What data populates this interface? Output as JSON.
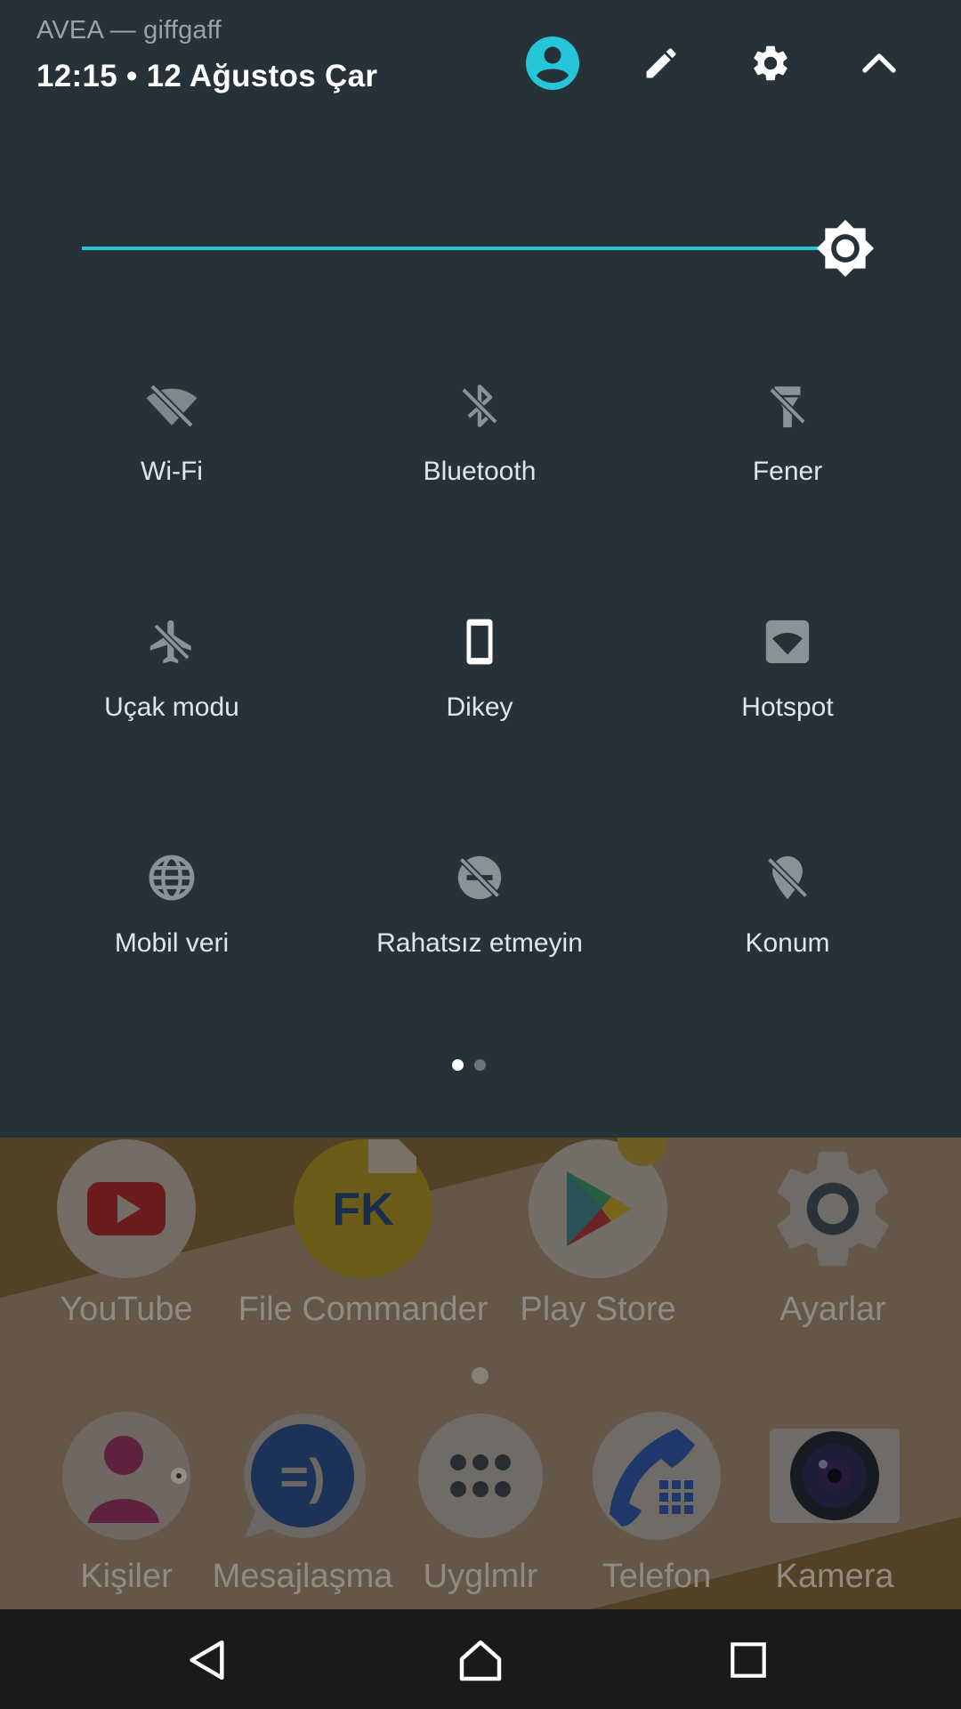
{
  "header": {
    "carrier": "AVEA — giffgaff",
    "datetime": "12:15 • 12 Ağustos Çar"
  },
  "header_icons": [
    "user-icon",
    "edit-icon",
    "settings-icon",
    "chevron-up-icon"
  ],
  "brightness": {
    "level": 0.98,
    "accent_color": "#26c6da"
  },
  "tiles": [
    {
      "label": "Wi-Fi",
      "icon": "wifi-off-icon",
      "state": "off"
    },
    {
      "label": "Bluetooth",
      "icon": "bluetooth-off-icon",
      "state": "off"
    },
    {
      "label": "Fener",
      "icon": "flashlight-off-icon",
      "state": "off"
    },
    {
      "label": "Uçak modu",
      "icon": "airplane-off-icon",
      "state": "off"
    },
    {
      "label": "Dikey",
      "icon": "portrait-phone-icon",
      "state": "on"
    },
    {
      "label": "Hotspot",
      "icon": "hotspot-icon",
      "state": "off"
    },
    {
      "label": "Mobil veri",
      "icon": "globe-icon",
      "state": "off"
    },
    {
      "label": "Rahatsız etmeyin",
      "icon": "do-not-disturb-off-icon",
      "state": "off"
    },
    {
      "label": "Konum",
      "icon": "location-off-icon",
      "state": "off"
    }
  ],
  "pager": {
    "pages": 2,
    "current": 1
  },
  "home": {
    "row1": [
      {
        "label": "YouTube",
        "icon": "youtube-icon"
      },
      {
        "label": "File Commander",
        "icon": "file-commander-icon"
      },
      {
        "label": "Play Store",
        "icon": "play-store-icon"
      },
      {
        "label": "Ayarlar",
        "icon": "settings-app-icon"
      }
    ],
    "dock": [
      {
        "label": "Kişiler",
        "icon": "contacts-icon"
      },
      {
        "label": "Mesajlaşma",
        "icon": "messaging-icon"
      },
      {
        "label": "Uyglmlr",
        "icon": "app-drawer-icon"
      },
      {
        "label": "Telefon",
        "icon": "phone-icon"
      },
      {
        "label": "Kamera",
        "icon": "camera-icon"
      }
    ]
  },
  "navbar": [
    "back-icon",
    "home-icon",
    "recents-icon"
  ]
}
